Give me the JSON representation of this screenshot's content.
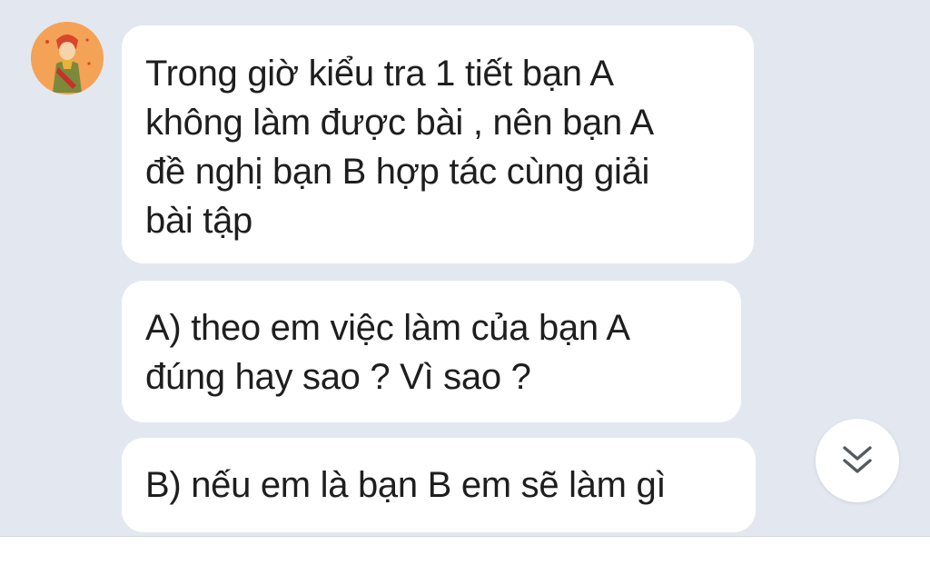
{
  "avatar": {
    "icon": "avatar-illustration-icon"
  },
  "messages": [
    {
      "lines": [
        "Trong giờ kiểu tra 1 tiết bạn A",
        "không làm được bài , nên bạn A",
        "đề nghị bạn B hợp tác cùng giải",
        "bài tập"
      ]
    },
    {
      "lines": [
        "A) theo em việc làm của bạn A",
        "đúng hay sao ? Vì sao ?"
      ]
    },
    {
      "lines": [
        "B) nếu em là bạn B em sẽ làm gì"
      ]
    }
  ],
  "scroll_button": {
    "icon": "double-chevron-down-icon"
  },
  "colors": {
    "background": "#e3e8f0",
    "bubble": "#ffffff",
    "text": "#1e1e1e",
    "avatar_accent": "#f4a256"
  }
}
